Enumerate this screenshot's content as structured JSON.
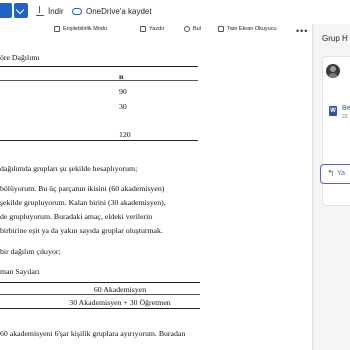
{
  "toolbar": {
    "download_label": "İndir",
    "onedrive_label": "OneDrive'a kaydet"
  },
  "reader_tools": {
    "accessibility_label": "Erişilebilirlik Modu",
    "print_label": "Yazdır",
    "find_label": "Bul",
    "immersive_label": "Tam Ekran Okuyucu",
    "more_label": "•••"
  },
  "document": {
    "table1_title": "öre Dağılımı",
    "table1_header": "n",
    "table1_values": [
      "90",
      "30",
      "120"
    ],
    "paragraphs": [
      "dağılımda grupları şu şekilde hesaplıyorum;",
      "bölüyorum. Bu üç parçanın ikisini (60 akademisyen)",
      "şekilde grupluyorum. Kalan birini (30 akademisyen),",
      "de grupluyorum. Buradaki amaç, eldeki verilerin",
      "birbirine eşit ya da yakın sayıda gruplar oluşturmak.",
      "bir dağılım çıkıyor;",
      "man Sayıları"
    ],
    "table2_rows": [
      "60 Akademisyen",
      "30 Akademisyen + 30 Öğretmen"
    ],
    "last_line": "60 akademisyeni 6'şar kişilik gruplara ayırıyorum. Buradan"
  },
  "panel": {
    "title": "Grup H",
    "file_label": "Be",
    "file_sub": "23",
    "reply_label": "Ya",
    "word_icon_letter": "W"
  }
}
